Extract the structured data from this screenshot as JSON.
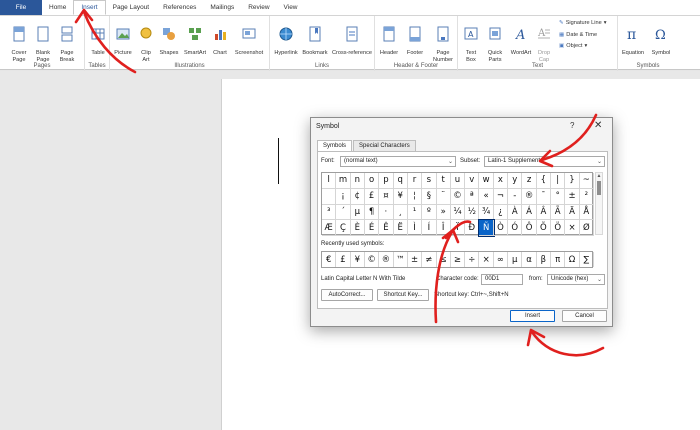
{
  "tabs": [
    {
      "label": "File"
    },
    {
      "label": "Home"
    },
    {
      "label": "Insert"
    },
    {
      "label": "Page Layout"
    },
    {
      "label": "References"
    },
    {
      "label": "Mailings"
    },
    {
      "label": "Review"
    },
    {
      "label": "View"
    }
  ],
  "ribbon": {
    "pages": {
      "label": "Pages",
      "cover": "Cover\nPage",
      "blank": "Blank\nPage",
      "break": "Page\nBreak"
    },
    "tables": {
      "label": "Tables",
      "table": "Table"
    },
    "illustrations": {
      "label": "Illustrations",
      "picture": "Picture",
      "clipart": "Clip\nArt",
      "shapes": "Shapes",
      "smartart": "SmartArt",
      "chart": "Chart",
      "screenshot": "Screenshot"
    },
    "links": {
      "label": "Links",
      "hyperlink": "Hyperlink",
      "bookmark": "Bookmark",
      "crossref": "Cross-reference"
    },
    "header_footer": {
      "label": "Header & Footer",
      "header": "Header",
      "footer": "Footer",
      "pagenum": "Page\nNumber"
    },
    "text": {
      "label": "Text",
      "textbox": "Text\nBox",
      "quickparts": "Quick\nParts",
      "wordart": "WordArt",
      "dropcap": "Drop\nCap",
      "sigline": "Signature Line",
      "datetime": "Date & Time",
      "object": "Object"
    },
    "symbols": {
      "label": "Symbols",
      "equation": "Equation",
      "symbol": "Symbol"
    }
  },
  "dialog": {
    "title": "Symbol",
    "help": "?",
    "close": "✕",
    "tab_symbols": "Symbols",
    "tab_special": "Special Characters",
    "font_label": "Font:",
    "font_value": "(normal text)",
    "subset_label": "Subset:",
    "subset_value": "Latin-1 Supplement",
    "grid": [
      [
        "l",
        "m",
        "n",
        "o",
        "p",
        "q",
        "r",
        "s",
        "t",
        "u",
        "v",
        "w",
        "x",
        "y",
        "z",
        "{",
        "|",
        "}",
        "~"
      ],
      [
        "",
        "¡",
        "¢",
        "£",
        "¤",
        "¥",
        "¦",
        "§",
        "¨",
        "©",
        "ª",
        "«",
        "¬",
        "-",
        "®",
        "¯",
        "°",
        "±",
        "²"
      ],
      [
        "³",
        "´",
        "µ",
        "¶",
        "·",
        "¸",
        "¹",
        "º",
        "»",
        "¼",
        "½",
        "¾",
        "¿",
        "À",
        "Á",
        "Â",
        "Ã",
        "Ä",
        "Å"
      ],
      [
        "Æ",
        "Ç",
        "È",
        "É",
        "Ê",
        "Ë",
        "Ì",
        "Í",
        "Î",
        "Ï",
        "Ð",
        "Ñ",
        "Ò",
        "Ó",
        "Ô",
        "Õ",
        "Ö",
        "×",
        "Ø"
      ]
    ],
    "selected_char": "Ñ",
    "recent_label": "Recently used symbols:",
    "recent": [
      "€",
      "£",
      "¥",
      "©",
      "®",
      "™",
      "±",
      "≠",
      "≤",
      "≥",
      "÷",
      "×",
      "∞",
      "µ",
      "α",
      "β",
      "π",
      "Ω",
      "∑"
    ],
    "char_name": "Latin Capital Letter N With Tilde",
    "char_code_label": "Character code:",
    "char_code": "00D1",
    "from_label": "from:",
    "from_value": "Unicode (hex)",
    "autocorrect": "AutoCorrect...",
    "shortcut_key_btn": "Shortcut Key...",
    "shortcut_text": "Shortcut key: Ctrl+~,Shift+N",
    "insert": "Insert",
    "cancel": "Cancel"
  },
  "colors": {
    "file_tab": "#2b579a",
    "selected_cell": "#0a64c8",
    "annotation": "#e0201e"
  }
}
